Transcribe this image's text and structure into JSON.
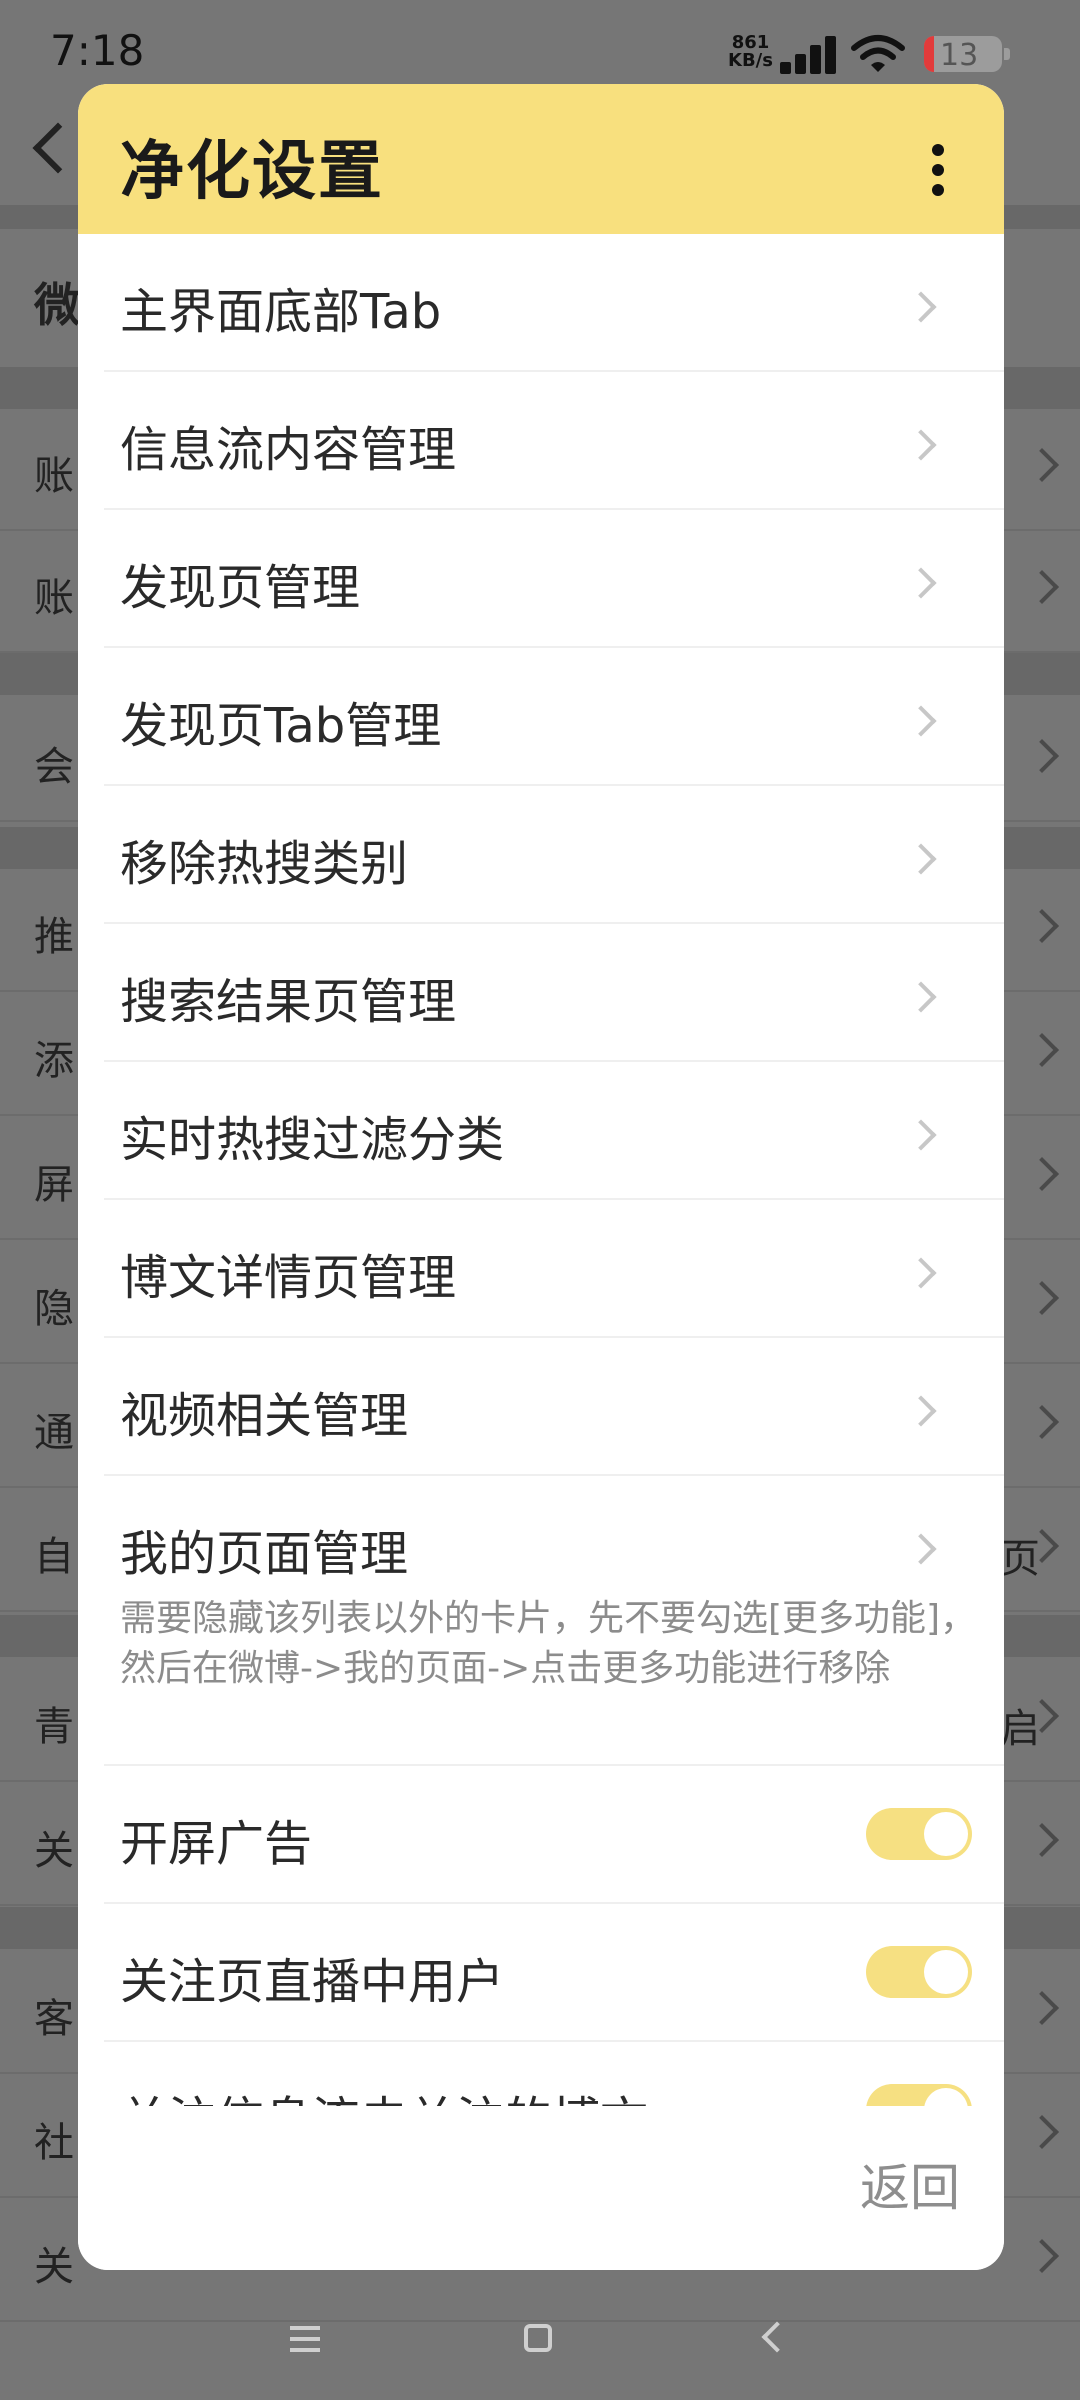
{
  "status_bar": {
    "time": "7:18",
    "net_speed_value": "861",
    "net_speed_unit": "KB/s",
    "battery": "13"
  },
  "background": {
    "back_text": "〈",
    "header_partial": "微",
    "rows": [
      {
        "label": "账",
        "right": ""
      },
      {
        "label": "账",
        "right": ""
      },
      {
        "label": "会",
        "right": ""
      },
      {
        "label": "推",
        "right": ""
      },
      {
        "label": "添",
        "right": ""
      },
      {
        "label": "屏",
        "right": ""
      },
      {
        "label": "隐",
        "right": ""
      },
      {
        "label": "通",
        "right": ""
      },
      {
        "label": "自",
        "right": "页"
      },
      {
        "label": "青",
        "right": "启"
      },
      {
        "label": "关",
        "right": ""
      },
      {
        "label": "客",
        "right": ""
      },
      {
        "label": "社",
        "right": ""
      },
      {
        "label": "关",
        "right": ""
      }
    ]
  },
  "dialog": {
    "title": "净化设置",
    "menu_icon": "more-vertical-icon",
    "items": [
      {
        "label": "主界面底部Tab",
        "type": "link"
      },
      {
        "label": "信息流内容管理",
        "type": "link"
      },
      {
        "label": "发现页管理",
        "type": "link"
      },
      {
        "label": "发现页Tab管理",
        "type": "link"
      },
      {
        "label": "移除热搜类别",
        "type": "link"
      },
      {
        "label": "搜索结果页管理",
        "type": "link"
      },
      {
        "label": "实时热搜过滤分类",
        "type": "link"
      },
      {
        "label": "博文详情页管理",
        "type": "link"
      },
      {
        "label": "视频相关管理",
        "type": "link"
      },
      {
        "label": "我的页面管理",
        "type": "link",
        "description": "需要隐藏该列表以外的卡片，先不要勾选[更多功能]，然后在微博->我的页面->点击更多功能进行移除"
      },
      {
        "label": "开屏广告",
        "type": "toggle",
        "on": true
      },
      {
        "label": "关注页直播中用户",
        "type": "toggle",
        "on": true
      },
      {
        "label": "关注信息流未关注的博文",
        "type": "toggle",
        "on": true
      }
    ],
    "back_button": "返回"
  },
  "colors": {
    "header_bg": "#f8e07e",
    "toggle_on": "#f6e082",
    "overlay": "#727272"
  }
}
